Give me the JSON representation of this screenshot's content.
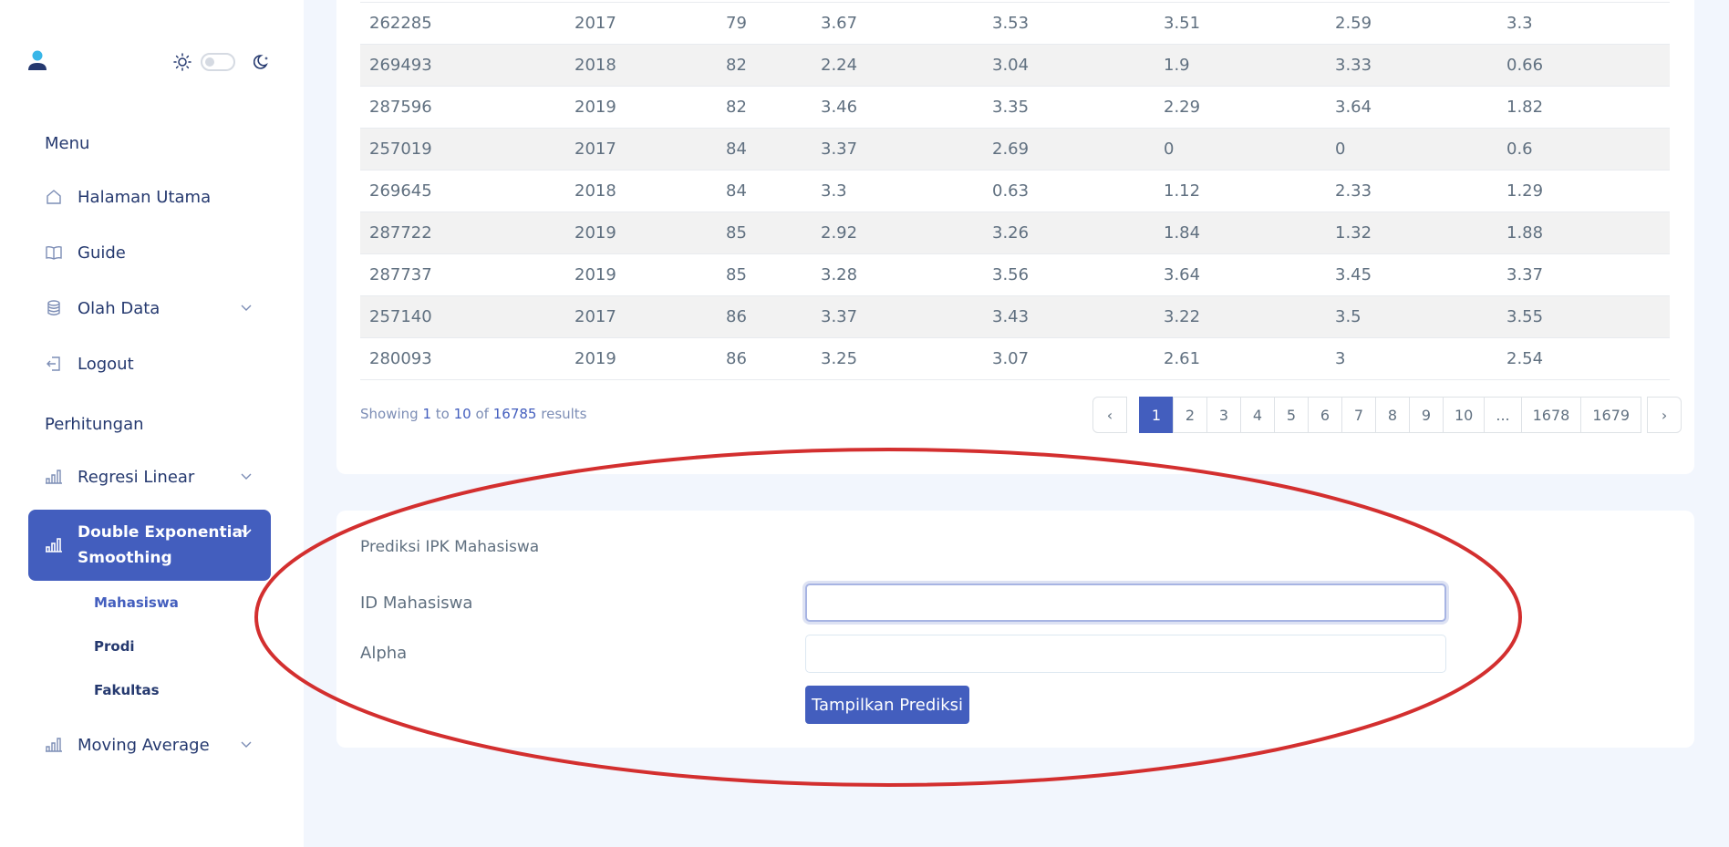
{
  "theme": {
    "accent": "#435ebe",
    "annotation": "#d32f2f"
  },
  "sidebar": {
    "user_icon": "user-icon",
    "theme_toggle": {
      "light_icon": "sun-icon",
      "dark_icon": "moon-icon",
      "state": "light"
    },
    "section_menu": "Menu",
    "items_menu": [
      {
        "label": "Halaman Utama",
        "icon": "home-icon"
      },
      {
        "label": "Guide",
        "icon": "book-icon"
      },
      {
        "label": "Olah Data",
        "icon": "database-icon",
        "has_submenu": true
      },
      {
        "label": "Logout",
        "icon": "logout-icon"
      }
    ],
    "section_perhitungan": "Perhitungan",
    "items_perhitungan": [
      {
        "label": "Regresi Linear",
        "icon": "bar-chart-icon",
        "has_submenu": true
      },
      {
        "label_line1": "Double Exponential",
        "label_line2": "Smoothing",
        "icon": "bar-chart-icon",
        "has_submenu": true,
        "active": true
      },
      {
        "label": "Moving Average",
        "icon": "bar-chart-icon",
        "has_submenu": true
      }
    ],
    "submenu": [
      {
        "label": "Mahasiswa",
        "current": true
      },
      {
        "label": "Prodi"
      },
      {
        "label": "Fakultas"
      }
    ]
  },
  "table": {
    "rows": [
      [
        "262285",
        "2017",
        "79",
        "3.67",
        "3.53",
        "3.51",
        "2.59",
        "3.3"
      ],
      [
        "269493",
        "2018",
        "82",
        "2.24",
        "3.04",
        "1.9",
        "3.33",
        "0.66"
      ],
      [
        "287596",
        "2019",
        "82",
        "3.46",
        "3.35",
        "2.29",
        "3.64",
        "1.82"
      ],
      [
        "257019",
        "2017",
        "84",
        "3.37",
        "2.69",
        "0",
        "0",
        "0.6"
      ],
      [
        "269645",
        "2018",
        "84",
        "3.3",
        "0.63",
        "1.12",
        "2.33",
        "1.29"
      ],
      [
        "287722",
        "2019",
        "85",
        "2.92",
        "3.26",
        "1.84",
        "1.32",
        "1.88"
      ],
      [
        "287737",
        "2019",
        "85",
        "3.28",
        "3.56",
        "3.64",
        "3.45",
        "3.37"
      ],
      [
        "257140",
        "2017",
        "86",
        "3.37",
        "3.43",
        "3.22",
        "3.5",
        "3.55"
      ],
      [
        "280093",
        "2019",
        "86",
        "3.25",
        "3.07",
        "2.61",
        "3",
        "2.54"
      ]
    ],
    "results": {
      "prefix": "Showing",
      "from": "1",
      "to_word": "to",
      "to": "10",
      "of_word": "of",
      "total": "16785",
      "suffix": "results"
    },
    "pagination": {
      "prev": "‹",
      "pages": [
        "1",
        "2",
        "3",
        "4",
        "5",
        "6",
        "7",
        "8",
        "9",
        "10",
        "...",
        "1678",
        "1679"
      ],
      "current": "1",
      "next": "›"
    }
  },
  "form": {
    "title": "Prediksi IPK Mahasiswa",
    "id_label": "ID Mahasiswa",
    "id_value": "",
    "alpha_label": "Alpha",
    "alpha_value": "",
    "submit_label": "Tampilkan Prediksi"
  }
}
